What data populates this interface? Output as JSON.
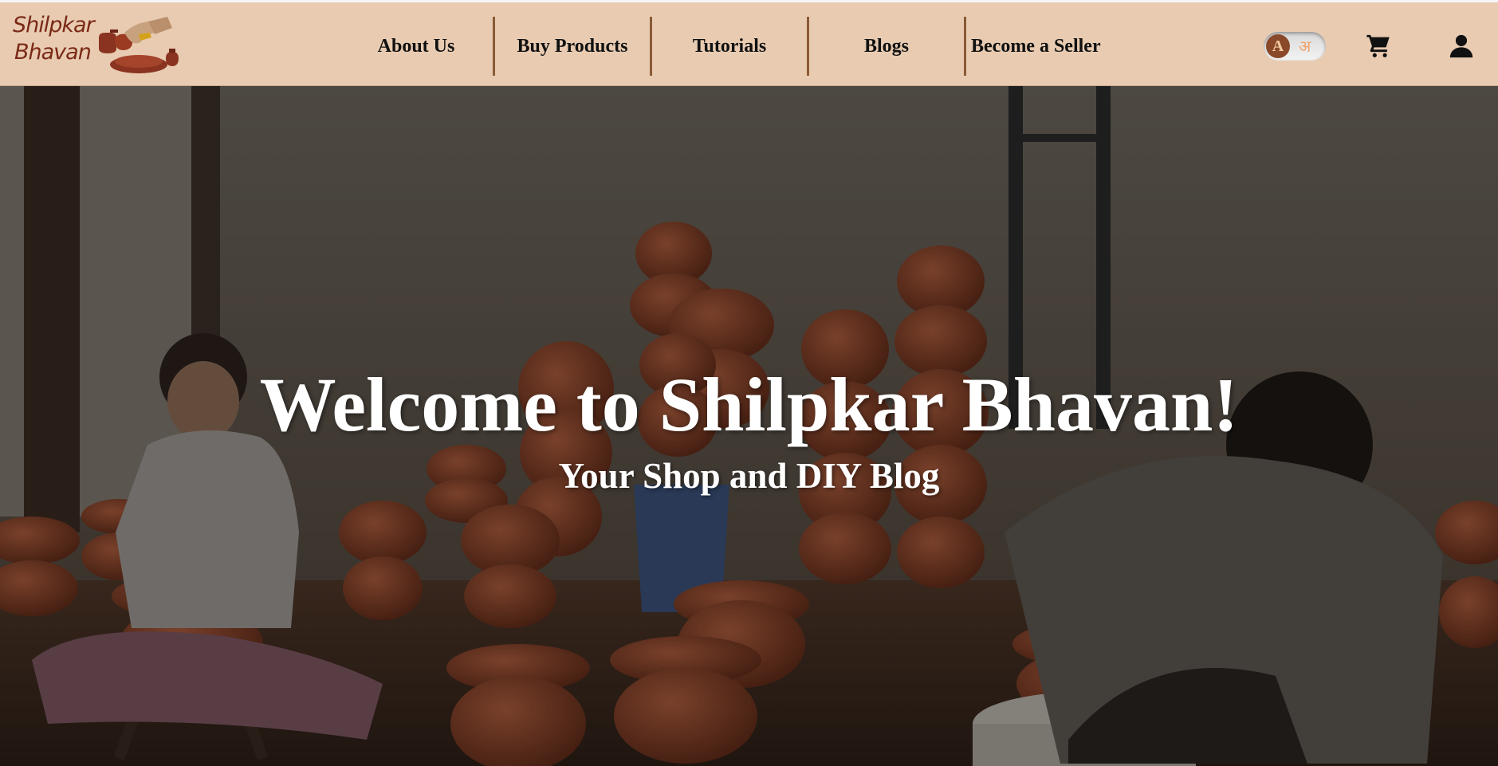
{
  "brand": {
    "logo_line1": "Shilpkar",
    "logo_line2": "Bhavan"
  },
  "nav": {
    "items": [
      {
        "label": "About Us"
      },
      {
        "label": "Buy Products"
      },
      {
        "label": "Tutorials"
      },
      {
        "label": "Blogs"
      },
      {
        "label": "Become a Seller"
      }
    ]
  },
  "language_toggle": {
    "active": "A",
    "alternate": "अ"
  },
  "icons": {
    "cart": "cart-icon",
    "user": "user-icon"
  },
  "hero": {
    "title": "Welcome to Shilpkar Bhavan!",
    "subtitle": "Your Shop and DIY Blog",
    "image": "pottery-workshop-photo"
  },
  "colors": {
    "header_bg": "#e8cbb1",
    "nav_separator": "#8a5a36",
    "brand_brown": "#7a2a17",
    "hero_text": "#ffffff"
  }
}
